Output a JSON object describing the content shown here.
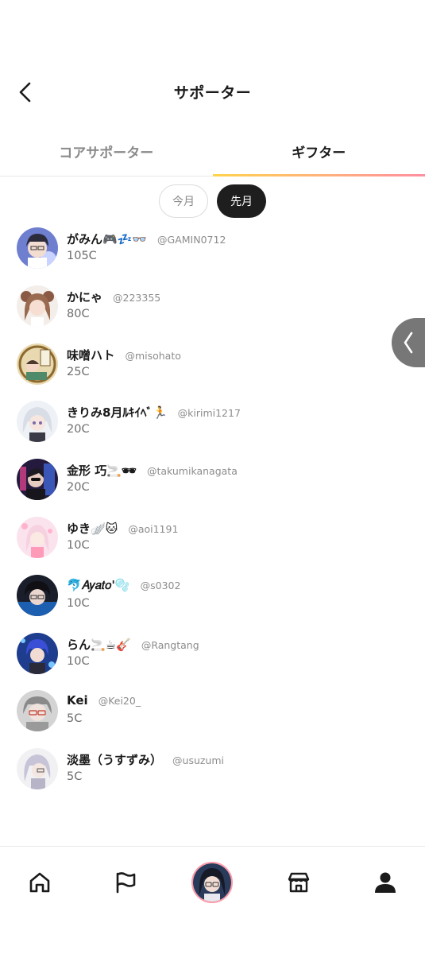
{
  "header": {
    "title": "サポーター",
    "back_icon": "chevron-left-icon"
  },
  "tabs": [
    {
      "label": "コアサポーター",
      "active": false
    },
    {
      "label": "ギフター",
      "active": true
    }
  ],
  "tab_underline_colors": [
    "#ffd34d",
    "#ffb37a",
    "#ff8fa0"
  ],
  "period": {
    "this_month": "今月",
    "last_month": "先月",
    "selected": "先月"
  },
  "supporters": [
    {
      "name": "がみん🎮💤👓",
      "handle": "@GAMIN0712",
      "coins": "105C"
    },
    {
      "name": "かにゃ",
      "handle": "@223355",
      "coins": "80C"
    },
    {
      "name": "味噌ハト",
      "handle": "@misohato",
      "coins": "25C"
    },
    {
      "name": "きりみ8月ﾙｷｲﾍﾞ🏃",
      "handle": "@kirimi1217",
      "coins": "20C"
    },
    {
      "name": "金形 巧🚬🕶",
      "handle": "@takumikanagata",
      "coins": "20C"
    },
    {
      "name": "ゆき🪽🐱",
      "handle": "@aoi1191",
      "coins": "10C"
    },
    {
      "name": "🐬𝐴𝑦𝑎𝑡𝑜'🫧",
      "handle": "@s0302",
      "coins": "10C"
    },
    {
      "name": "らん🚬☕🎸",
      "handle": "@Rangtang",
      "coins": "10C"
    },
    {
      "name": "Kei",
      "handle": "@Kei20_",
      "coins": "5C"
    },
    {
      "name": "淡墨（うすずみ）",
      "handle": "@usuzumi",
      "coins": "5C"
    }
  ],
  "side_drawer": {
    "icon": "chevron-left-icon"
  },
  "bottom_nav": [
    {
      "icon": "home-icon"
    },
    {
      "icon": "flag-icon"
    },
    {
      "icon": "profile-avatar"
    },
    {
      "icon": "store-icon"
    },
    {
      "icon": "user-icon"
    }
  ],
  "colors": {
    "accent_dark": "#1e1e1e",
    "side_handle": "#777777",
    "nav_avatar_ring": "#ff9aa8"
  }
}
